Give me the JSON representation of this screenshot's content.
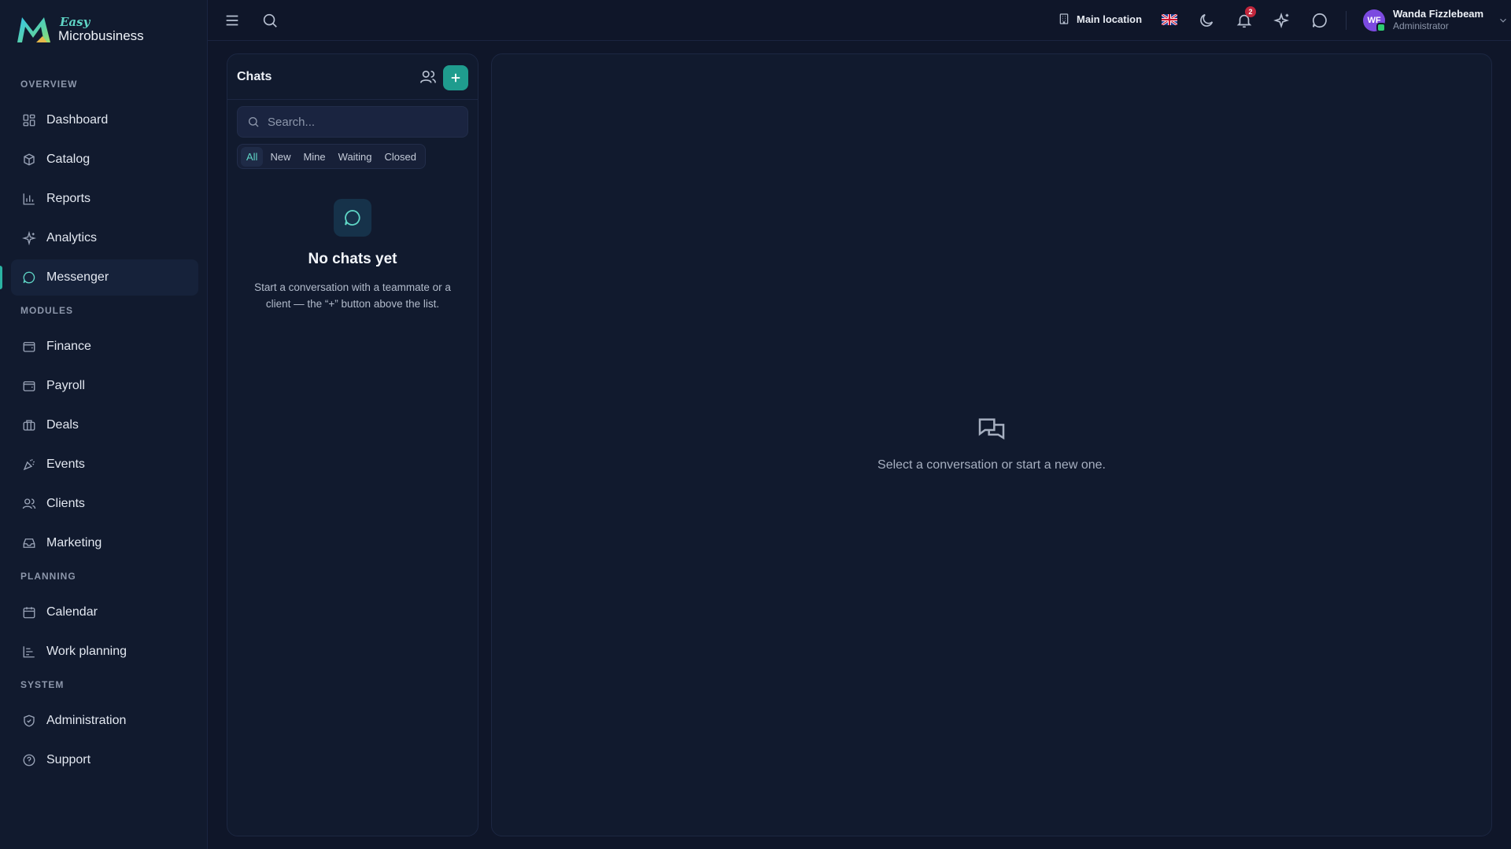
{
  "brand": {
    "easy": "Easy",
    "name": "Microbusiness"
  },
  "sidebar": {
    "sections": [
      {
        "title": "OVERVIEW",
        "items": [
          {
            "label": "Dashboard",
            "icon": "dashboard-icon"
          },
          {
            "label": "Catalog",
            "icon": "box-icon"
          },
          {
            "label": "Reports",
            "icon": "bar-chart-icon"
          },
          {
            "label": "Analytics",
            "icon": "sparkles-icon"
          },
          {
            "label": "Messenger",
            "icon": "message-icon",
            "active": true
          }
        ]
      },
      {
        "title": "MODULES",
        "items": [
          {
            "label": "Finance",
            "icon": "wallet-icon"
          },
          {
            "label": "Payroll",
            "icon": "wallet-icon"
          },
          {
            "label": "Deals",
            "icon": "briefcase-icon"
          },
          {
            "label": "Events",
            "icon": "party-icon"
          },
          {
            "label": "Clients",
            "icon": "users-icon"
          },
          {
            "label": "Marketing",
            "icon": "inbox-icon"
          }
        ]
      },
      {
        "title": "PLANNING",
        "items": [
          {
            "label": "Calendar",
            "icon": "calendar-icon"
          },
          {
            "label": "Work planning",
            "icon": "gantt-icon"
          }
        ]
      },
      {
        "title": "SYSTEM",
        "items": [
          {
            "label": "Administration",
            "icon": "shield-icon"
          },
          {
            "label": "Support",
            "icon": "help-icon"
          }
        ]
      }
    ]
  },
  "topbar": {
    "location": "Main location",
    "notifications_count": "2",
    "user": {
      "initials": "WF",
      "name": "Wanda Fizzlebeam",
      "role": "Administrator"
    }
  },
  "chats": {
    "title": "Chats",
    "search_placeholder": "Search...",
    "filters": [
      "All",
      "New",
      "Mine",
      "Waiting",
      "Closed"
    ],
    "active_filter": "All",
    "empty_title": "No chats yet",
    "empty_text": "Start a conversation with a teammate or a client — the “+” button above the list."
  },
  "conversation": {
    "empty_text": "Select a conversation or start a new one."
  },
  "colors": {
    "background": "#0f1629",
    "panel": "#111a2e",
    "accent": "#1f9c8e",
    "accent_light": "#5fd6c6",
    "badge": "#c0263c",
    "avatar": "#7b4ae0"
  }
}
